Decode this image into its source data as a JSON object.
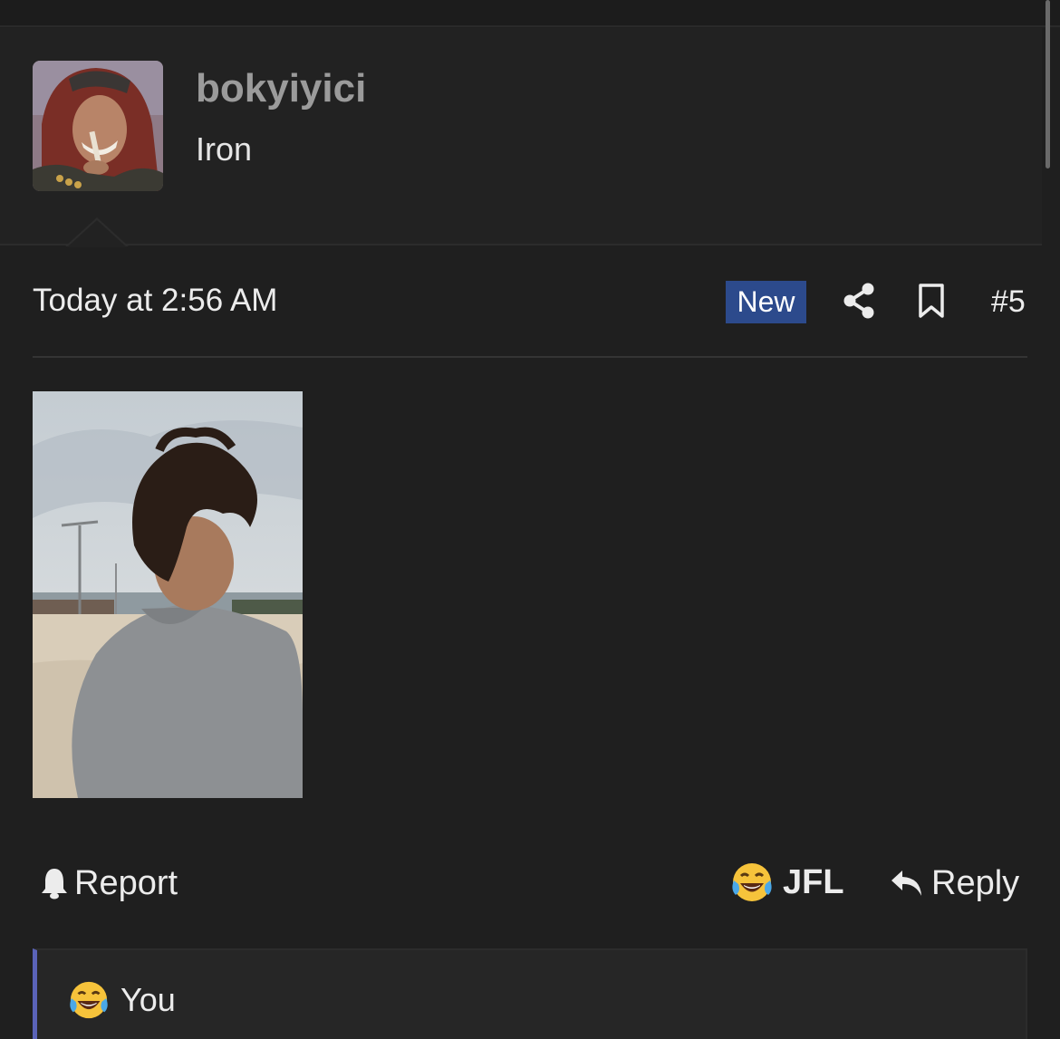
{
  "post": {
    "username": "bokyiyici",
    "user_title": "Iron",
    "timestamp": "Today at 2:56 AM",
    "new_badge": "New",
    "post_number": "#5"
  },
  "actions": {
    "report_label": "Report",
    "reaction_label": "JFL",
    "reply_label": "Reply"
  },
  "reactions_summary": {
    "text": "You"
  },
  "icons": {
    "share": "share-icon",
    "bookmark": "bookmark-icon",
    "report": "bell-icon",
    "reply": "reply-arrow-icon",
    "reaction": "laughing-crying-emoji-icon"
  },
  "colors": {
    "background": "#1f1f1f",
    "panel": "#222222",
    "new_badge": "#2c4a8c",
    "reactions_accent": "#5a63b8",
    "username": "#9b9b9b"
  }
}
